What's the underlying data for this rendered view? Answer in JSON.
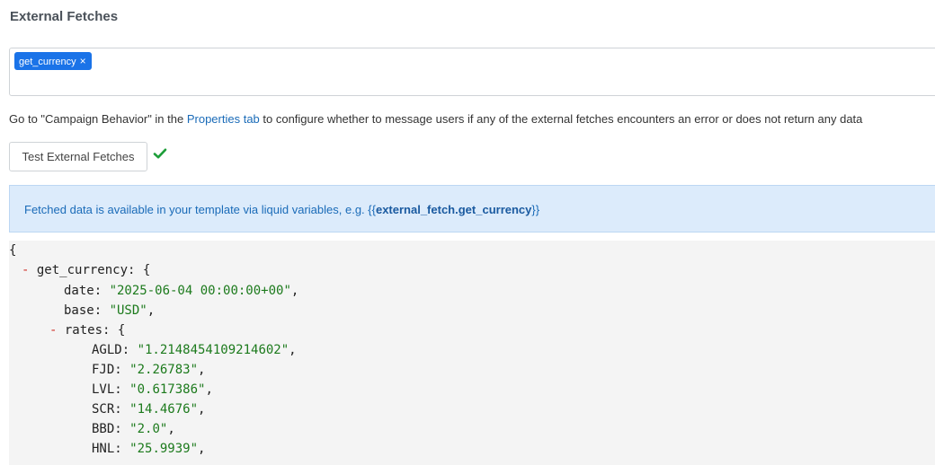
{
  "header": {
    "title": "External Fetches"
  },
  "tags": [
    {
      "label": "get_currency",
      "remove": "×"
    }
  ],
  "help": {
    "prefix": "Go to \"Campaign Behavior\" in the ",
    "link": "Properties tab",
    "suffix": " to configure whether to message users if any of the external fetches encounters an error or does not return any data"
  },
  "test_button": {
    "label": "Test External Fetches",
    "status": "success"
  },
  "info": {
    "text": "Fetched data is available in your template via liquid variables, e.g. ",
    "open": "{{",
    "variable": "external_fetch.get_currency",
    "close": "}}"
  },
  "code": {
    "open_brace": "{",
    "root_key": "get_currency: {",
    "date_key": "date: ",
    "date_val": "\"2025-06-04 00:00:00+00\"",
    "base_key": "base: ",
    "base_val": "\"USD\"",
    "rates_key": "rates: {",
    "rates": [
      {
        "key": "AGLD: ",
        "val": "\"1.2148454109214602\""
      },
      {
        "key": "FJD: ",
        "val": "\"2.26783\""
      },
      {
        "key": "LVL: ",
        "val": "\"0.617386\""
      },
      {
        "key": "SCR: ",
        "val": "\"14.4676\""
      },
      {
        "key": "BBD: ",
        "val": "\"2.0\""
      },
      {
        "key": "HNL: ",
        "val": "\"25.9939\""
      }
    ],
    "comma": ",",
    "collapse": "-"
  },
  "colors": {
    "accent": "#1a73e8",
    "success": "#1e9e3a",
    "minus": "#d0342c",
    "string": "#1c7a1c"
  }
}
